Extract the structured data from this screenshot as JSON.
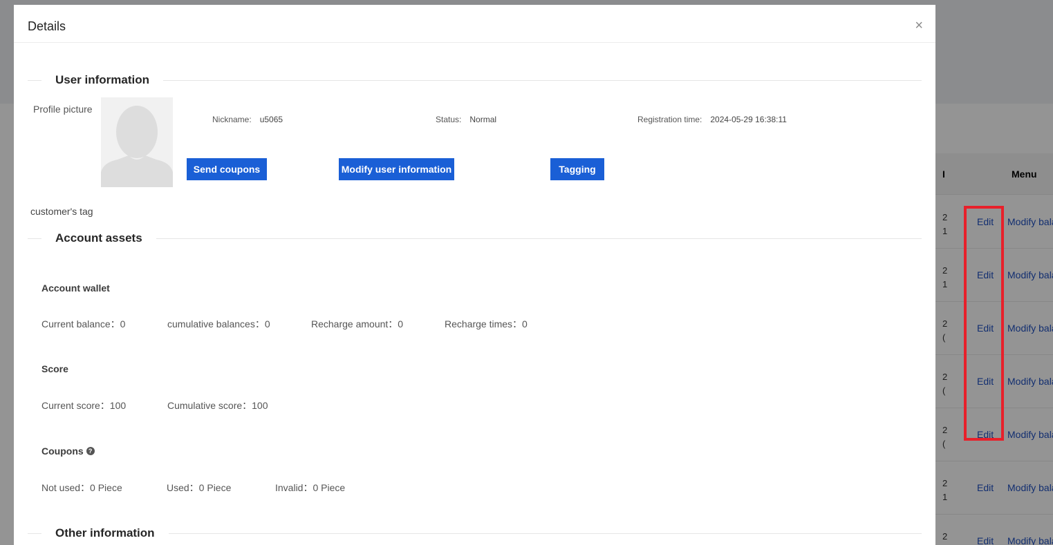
{
  "background": {
    "table_header_partial": "I",
    "table_header_menu": "Menu",
    "rows": [
      {
        "cut": "2\n1",
        "edit": "Edit",
        "modify": "Modify bala"
      },
      {
        "cut": "2\n1",
        "edit": "Edit",
        "modify": "Modify bala"
      },
      {
        "cut": "2\n(",
        "edit": "Edit",
        "modify": "Modify bala"
      },
      {
        "cut": "2\n(",
        "edit": "Edit",
        "modify": "Modify bala"
      },
      {
        "cut": "2\n(",
        "edit": "Edit",
        "modify": "Modify bala"
      },
      {
        "cut": "2\n1",
        "edit": "Edit",
        "modify": "Modify bala"
      },
      {
        "cut": "2",
        "edit": "Edit",
        "modify": "Modify bala"
      }
    ]
  },
  "modal": {
    "title": "Details",
    "close_glyph": "×"
  },
  "user_info": {
    "section_title": "User information",
    "profile_label": "Profile picture",
    "nickname_label": "Nickname:",
    "nickname": "u5065",
    "status_label": "Status:",
    "status": "Normal",
    "registration_label": "Registration time:",
    "registration_time": "2024-05-29 16:38:11",
    "buttons": {
      "send_coupons": "Send coupons",
      "modify_user": "Modify user information",
      "tagging": "Tagging"
    },
    "customer_tag_label": "customer's tag"
  },
  "account_assets": {
    "section_title": "Account assets",
    "wallet": {
      "title": "Account wallet",
      "current_balance": "Current balance：0",
      "cumulative_balances": "cumulative balances：0",
      "recharge_amount": "Recharge amount：0",
      "recharge_times": "Recharge times：0"
    },
    "score": {
      "title": "Score",
      "current_score": "Current score：100",
      "cumulative_score": "Cumulative score：100"
    },
    "coupons": {
      "title": "Coupons",
      "help_glyph": "?",
      "not_used": "Not used：0  Piece",
      "used": "Used：0  Piece",
      "invalid": "Invalid：0  Piece"
    }
  },
  "other_info": {
    "section_title": "Other information"
  }
}
